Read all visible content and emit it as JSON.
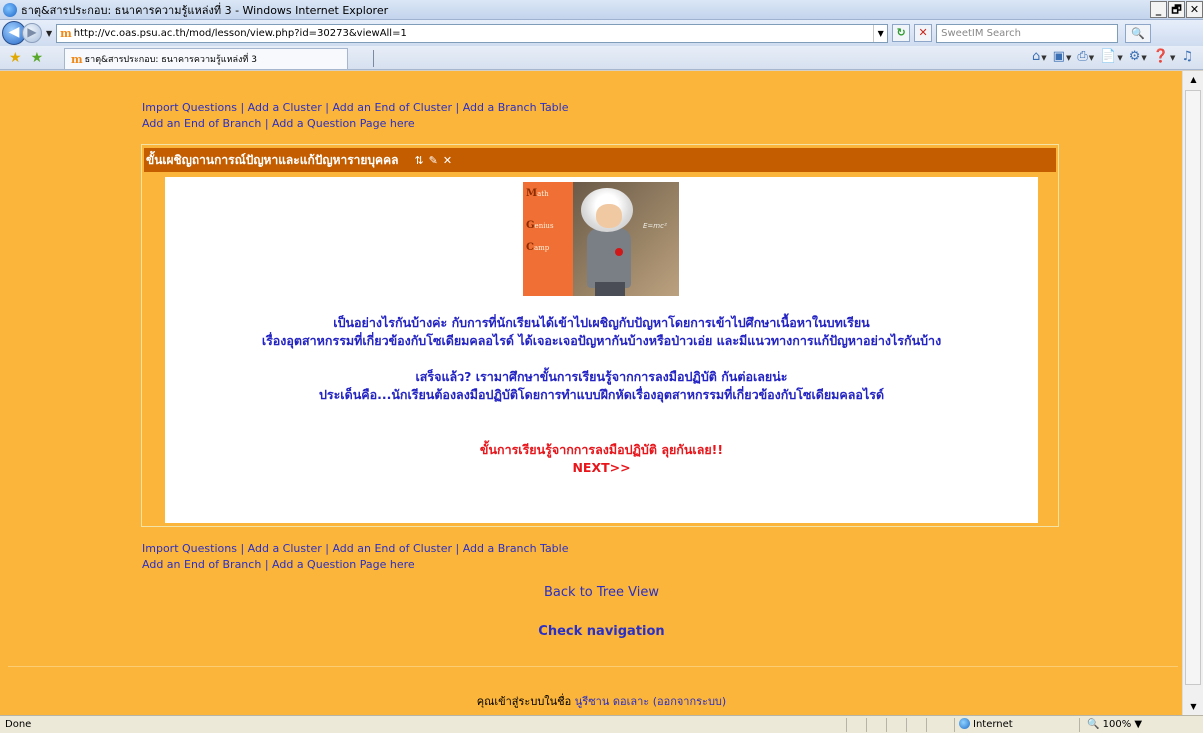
{
  "window": {
    "title": "ธาตุ&สารประกอบ: ธนาคารความรู้แหล่งที่ 3 - Windows Internet Explorer",
    "controls": [
      "_",
      "🗗",
      "✕"
    ]
  },
  "address_bar": {
    "url": "http://vc.oas.psu.ac.th/mod/lesson/view.php?id=30273&viewAll=1",
    "search_placeholder": "SweetIM Search"
  },
  "tab": {
    "title": "ธาตุ&สารประกอบ: ธนาคารความรู้แหล่งที่ 3"
  },
  "edit_links": {
    "import_questions": "Import Questions",
    "add_cluster": "Add a Cluster",
    "add_end_cluster": "Add an End of Cluster",
    "add_branch_table": "Add a Branch Table",
    "add_end_branch": "Add an End of Branch",
    "add_question_page": "Add a Question Page here",
    "separator": "|"
  },
  "lesson_page": {
    "title": "ขั้นเผชิญถานการณ์ปัญหาและแก้ปัญหารายบุคคล",
    "image_letters": [
      {
        "cap": "M",
        "rest": "ath"
      },
      {
        "cap": "G",
        "rest": "enius"
      },
      {
        "cap": "C",
        "rest": "amp"
      }
    ],
    "image_equation": "E=mc²",
    "paragraph1_line1": "เป็นอย่างไรกันบ้างค่ะ กับการที่นักเรียนได้เข้าไปเผชิญกับปัญหาโดยการเข้าไปศึกษาเนื้อหาในบทเรียน",
    "paragraph1_line2": "เรื่องอุตสาหกรรมที่เกี่ยวข้องกับโซเดียมคลอไรด์  ได้เจอะเจอปัญหากันบ้างหรือป่าวเอ่ย และมีแนวทางการแก้ปัญหาอย่างไรกันบ้าง",
    "paragraph2_line1": "เสร็จแล้ว? เรามาศึกษาขั้นการเรียนรู้จากการลงมือปฏิบัติ กันต่อเลยน่ะ",
    "paragraph2_line2": "ประเด็นคือ...นักเรียนต้องลงมือปฏิบัติโดยการทำแบบฝึกหัดเรื่องอุตสาหกรรมที่เกี่ยวข้องกับโซเดียมคลอไรด์",
    "red_line1": "ขั้นการเรียนรู้จากการลงมือปฏิบัติ ลุยกันเลย!!",
    "next_link": "NEXT>>"
  },
  "back_to_tree": "Back to Tree View",
  "check_navigation": "Check navigation",
  "footer": {
    "prefix": "คุณเข้าสู่ระบบในชื่อ",
    "user": "นูรีซาน ดอเลาะ",
    "logout": "(ออกจากระบบ)"
  },
  "status_bar": {
    "status": "Done",
    "zone": "Internet",
    "zoom": "100%"
  }
}
